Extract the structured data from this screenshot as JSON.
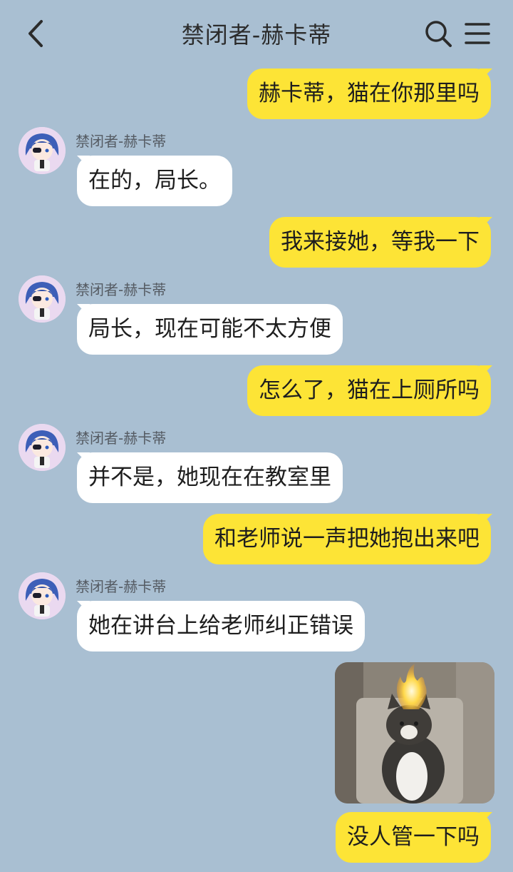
{
  "header": {
    "title": "禁闭者-赫卡蒂",
    "back_icon": "chevron-left-icon",
    "search_icon": "search-icon",
    "menu_icon": "menu-icon"
  },
  "colors": {
    "background": "#a9bfd2",
    "outgoing_bubble": "#fde436",
    "incoming_bubble": "#ffffff"
  },
  "contact": {
    "name": "禁闭者-赫卡蒂"
  },
  "messages": [
    {
      "direction": "out",
      "text": "赫卡蒂，猫在你那里吗"
    },
    {
      "direction": "in",
      "sender": "禁闭者-赫卡蒂",
      "text": "在的，局长。"
    },
    {
      "direction": "out",
      "text": "我来接她，等我一下"
    },
    {
      "direction": "in",
      "sender": "禁闭者-赫卡蒂",
      "text": "局长，现在可能不太方便"
    },
    {
      "direction": "out",
      "text": "怎么了，猫在上厕所吗"
    },
    {
      "direction": "in",
      "sender": "禁闭者-赫卡蒂",
      "text": "并不是，她现在在教室里"
    },
    {
      "direction": "out",
      "text": "和老师说一声把她抱出来吧"
    },
    {
      "direction": "in",
      "sender": "禁闭者-赫卡蒂",
      "text": "她在讲台上给老师纠正错误"
    },
    {
      "direction": "out",
      "type": "image",
      "image_subject": "cat-with-flaming-head-meme"
    },
    {
      "direction": "out",
      "text": "没人管一下吗"
    }
  ]
}
